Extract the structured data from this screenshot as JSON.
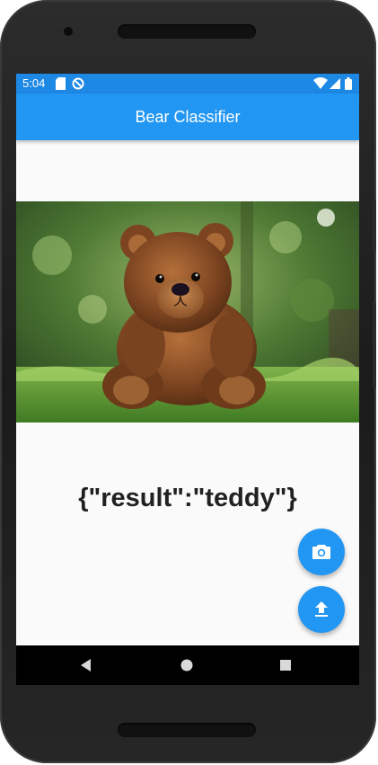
{
  "status_bar": {
    "time": "5:04",
    "icons": [
      "sd-card-icon",
      "sync-icon",
      "wifi-icon",
      "signal-icon",
      "battery-icon"
    ]
  },
  "app_bar": {
    "title": "Bear Classifier",
    "color": "#2196F3"
  },
  "image": {
    "description_icon": "teddy-bear-photo"
  },
  "result": {
    "text": "{\"result\":\"teddy\"}"
  },
  "fabs": {
    "camera_icon": "camera-icon",
    "upload_icon": "upload-icon",
    "color": "#2196F3"
  },
  "nav_bar": {
    "buttons": [
      "back-icon",
      "home-icon",
      "recents-icon"
    ]
  }
}
